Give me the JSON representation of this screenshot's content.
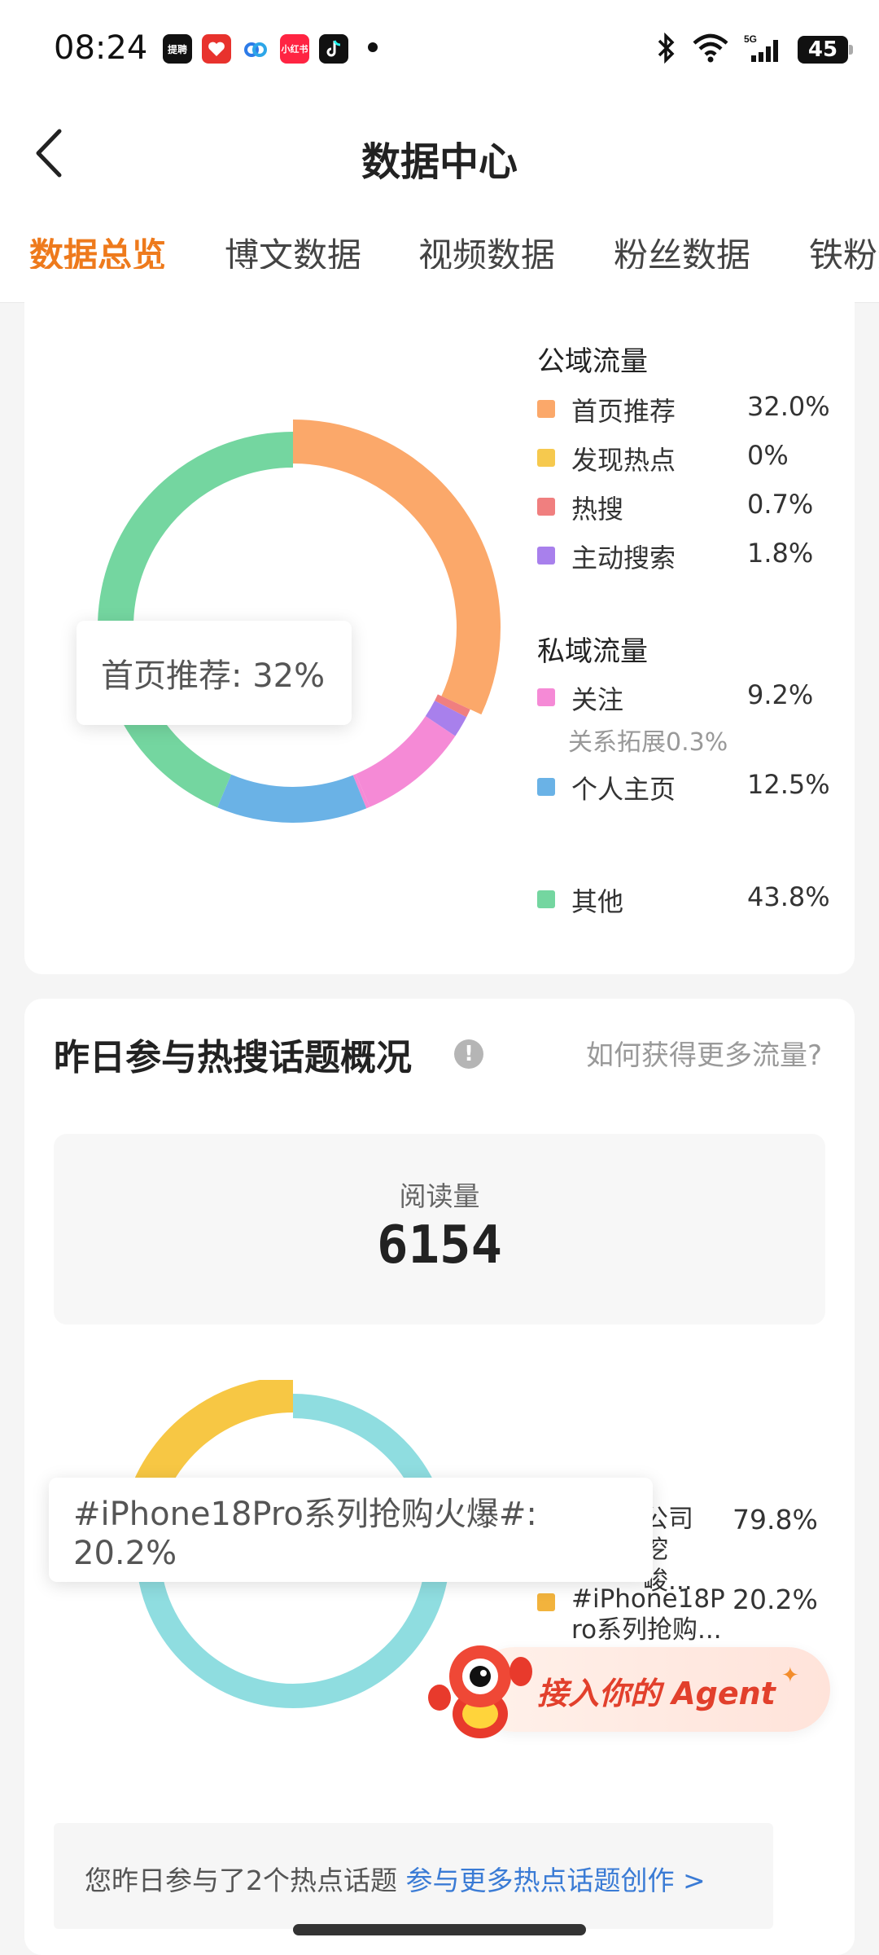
{
  "status_bar": {
    "time": "08:24",
    "apps": [
      "haokan",
      "redbook-heart",
      "baidu-cloud",
      "xiaohongshu",
      "tiktok"
    ],
    "app_labels": {
      "haokan": "提聘",
      "xiaohongshu": "小红书"
    },
    "network": "5G",
    "battery": "45"
  },
  "header": {
    "title": "数据中心",
    "back_icon": "chevron-left-icon"
  },
  "tabs": [
    {
      "label": "数据总览",
      "active": true
    },
    {
      "label": "博文数据",
      "active": false
    },
    {
      "label": "视频数据",
      "active": false
    },
    {
      "label": "粉丝数据",
      "active": false
    },
    {
      "label": "铁粉数据",
      "active": false
    }
  ],
  "traffic": {
    "public_title": "公域流量",
    "public_items": [
      {
        "label": "首页推荐",
        "value": "32.0%",
        "color": "#fba86a"
      },
      {
        "label": "发现热点",
        "value": "0%",
        "color": "#f6c94e"
      },
      {
        "label": "热搜",
        "value": "0.7%",
        "color": "#f07f7f"
      },
      {
        "label": "主动搜索",
        "value": "1.8%",
        "color": "#a880ec"
      }
    ],
    "private_title": "私域流量",
    "private_items": [
      {
        "label": "关注",
        "value": "9.2%",
        "color": "#f58ad6"
      },
      {
        "label": "个人主页",
        "value": "12.5%",
        "color": "#6ab2e6"
      }
    ],
    "relation_note": "关系拓展0.3%",
    "other": {
      "label": "其他",
      "value": "43.8%",
      "color": "#74d6a0"
    },
    "tooltip": "首页推荐: 32%"
  },
  "chart_data": [
    {
      "type": "pie",
      "title": "",
      "categories": [
        "首页推荐",
        "发现热点",
        "热搜",
        "主动搜索",
        "关注",
        "关系拓展",
        "个人主页",
        "其他"
      ],
      "values": [
        32.0,
        0,
        0.7,
        1.8,
        9.2,
        0.3,
        12.5,
        43.8
      ],
      "colors": [
        "#fba86a",
        "#f6c94e",
        "#f07f7f",
        "#a880ec",
        "#f58ad6",
        "#f58ad6",
        "#6ab2e6",
        "#74d6a0"
      ]
    },
    {
      "type": "pie",
      "title": "",
      "categories": [
        "...公司挖...峻...",
        "#iPhone18Pro系列抢购..."
      ],
      "values": [
        79.8,
        20.2
      ],
      "colors": [
        "#8fdde0",
        "#f7c744"
      ]
    }
  ],
  "hot_topics": {
    "title": "昨日参与热搜话题概况",
    "info_icon": "exclamation-icon",
    "how_link": "如何获得更多流量?",
    "read_label": "阅读量",
    "read_value": "6154",
    "tooltip": "#iPhone18Pro系列抢购火爆#: 20.2%",
    "legend": [
      {
        "label": "公司挖峻...",
        "value": "79.8%",
        "color": "#8fdde0"
      },
      {
        "label": "#iPhone18Pro系列抢购...",
        "value": "20.2%",
        "color": "#f2b33d"
      }
    ],
    "agent_button": "接入你的 Agent",
    "bottom_text": "您昨日参与了2个热点话题",
    "bottom_link": "参与更多热点话题创作 >"
  }
}
